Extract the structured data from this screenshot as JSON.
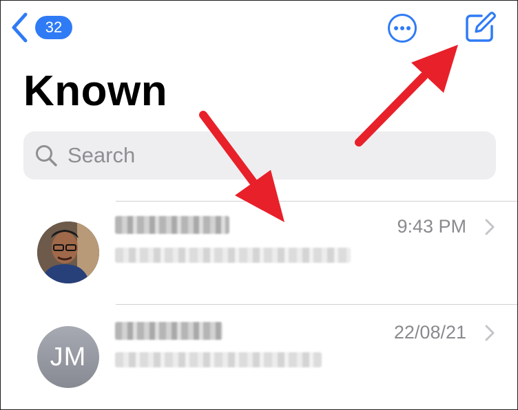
{
  "nav": {
    "unread_count": "32"
  },
  "header": {
    "title": "Known"
  },
  "search": {
    "placeholder": "Search"
  },
  "conversations": [
    {
      "avatar_type": "photo",
      "time": "9:43 PM"
    },
    {
      "avatar_type": "initials",
      "initials": "JM",
      "time": "22/08/21"
    }
  ],
  "icons": {
    "back": "chevron-left-icon",
    "more": "ellipsis-circle-icon",
    "compose": "compose-icon",
    "search": "magnifying-glass-icon",
    "row_disclosure": "chevron-right-icon"
  },
  "colors": {
    "accent": "#2f7bf5",
    "annotation": "#e8202a",
    "secondary_text": "#8a8a8e",
    "search_background": "#eeeef0"
  }
}
